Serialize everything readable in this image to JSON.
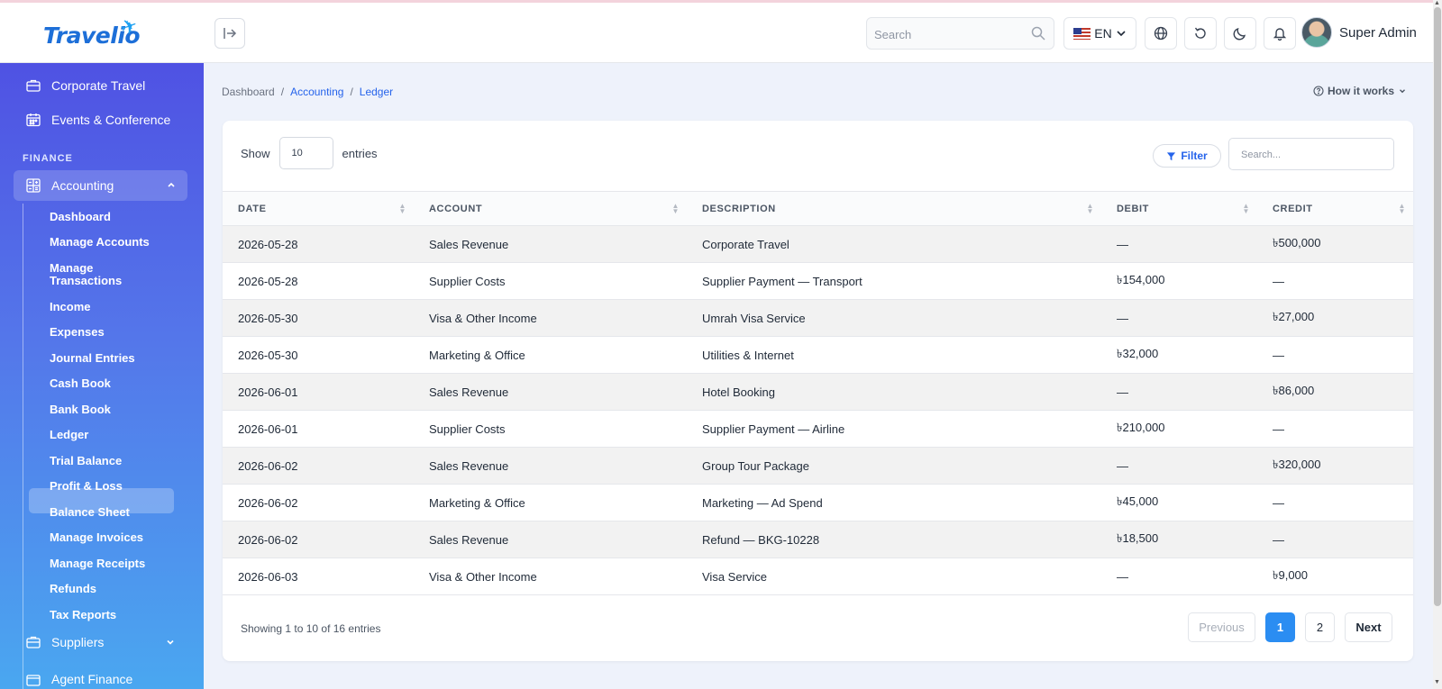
{
  "app": {
    "logo_text": "Travelio"
  },
  "topbar": {
    "search_placeholder": "Search",
    "language": "EN",
    "user_name": "Super Admin"
  },
  "sidebar": {
    "top_items": [
      {
        "label": "Corporate Travel",
        "icon": "briefcase-icon"
      },
      {
        "label": "Events & Conference",
        "icon": "calendar-icon"
      }
    ],
    "section_label": "FINANCE",
    "accounting": {
      "label": "Accounting",
      "items": [
        "Dashboard",
        "Manage Accounts",
        "Manage Transactions",
        "Income",
        "Expenses",
        "Journal Entries",
        "Cash Book",
        "Bank Book",
        "Ledger",
        "Trial Balance",
        "Profit & Loss",
        "Balance Sheet",
        "Manage Invoices",
        "Manage Receipts",
        "Refunds",
        "Tax Reports"
      ],
      "active": "Ledger"
    },
    "suppliers_label": "Suppliers",
    "agent_finance_label": "Agent Finance"
  },
  "breadcrumb": {
    "home": "Dashboard",
    "section": "Accounting",
    "page": "Ledger"
  },
  "how_it_works": "How it works",
  "controls": {
    "show_label": "Show",
    "entries_value": "10",
    "entries_label": "entries",
    "filter_label": "Filter",
    "search_placeholder": "Search..."
  },
  "table": {
    "headers": [
      "DATE",
      "ACCOUNT",
      "DESCRIPTION",
      "DEBIT",
      "CREDIT"
    ],
    "rows": [
      [
        "2026-05-28",
        "Sales Revenue",
        "Corporate Travel",
        "—",
        "৳500,000"
      ],
      [
        "2026-05-28",
        "Supplier Costs",
        "Supplier Payment — Transport",
        "৳154,000",
        "—"
      ],
      [
        "2026-05-30",
        "Visa & Other Income",
        "Umrah Visa Service",
        "—",
        "৳27,000"
      ],
      [
        "2026-05-30",
        "Marketing & Office",
        "Utilities & Internet",
        "৳32,000",
        "—"
      ],
      [
        "2026-06-01",
        "Sales Revenue",
        "Hotel Booking",
        "—",
        "৳86,000"
      ],
      [
        "2026-06-01",
        "Supplier Costs",
        "Supplier Payment — Airline",
        "৳210,000",
        "—"
      ],
      [
        "2026-06-02",
        "Sales Revenue",
        "Group Tour Package",
        "—",
        "৳320,000"
      ],
      [
        "2026-06-02",
        "Marketing & Office",
        "Marketing — Ad Spend",
        "৳45,000",
        "—"
      ],
      [
        "2026-06-02",
        "Sales Revenue",
        "Refund — BKG-10228",
        "৳18,500",
        "—"
      ],
      [
        "2026-06-03",
        "Visa & Other Income",
        "Visa Service",
        "—",
        "৳9,000"
      ]
    ]
  },
  "pagination": {
    "summary": "Showing 1 to 10 of 16 entries",
    "previous": "Previous",
    "pages": [
      "1",
      "2"
    ],
    "current": "1",
    "next": "Next"
  },
  "colors": {
    "accent": "#2b8df2",
    "sidebar_top": "#4f52e3",
    "sidebar_bottom": "#4aa7f0"
  }
}
